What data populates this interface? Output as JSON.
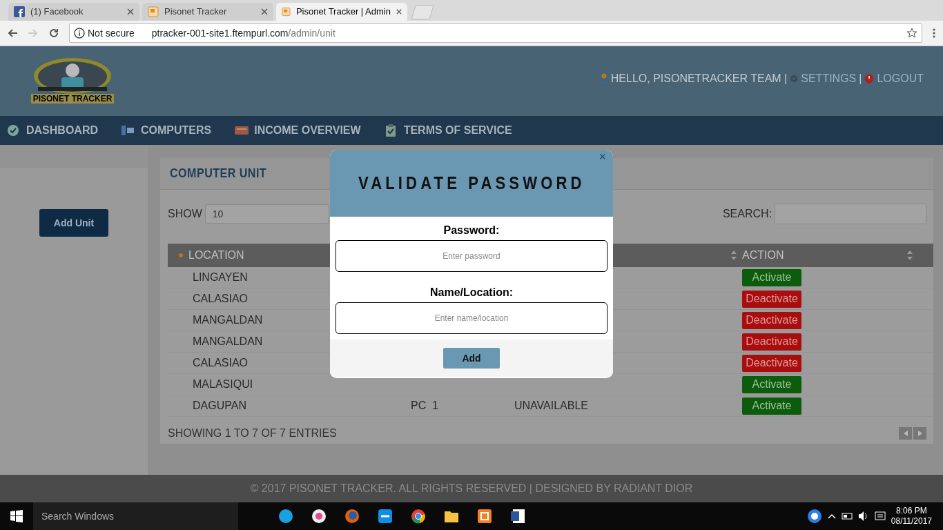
{
  "browser": {
    "tabs": [
      {
        "title": "(1) Facebook",
        "kind": "facebook",
        "selected": false
      },
      {
        "title": "Pisonet Tracker",
        "kind": "site",
        "selected": false
      },
      {
        "title": "Pisonet Tracker | Admin",
        "kind": "site",
        "selected": true
      }
    ],
    "address": {
      "security": "Not secure",
      "host": "ptracker-001-site1.ftempurl.com",
      "path": "/admin/unit"
    }
  },
  "header": {
    "logo_text": "PISONET TRACKER",
    "greeting": "HELLO, PISONETRACKER TEAM |",
    "settings": "SETTINGS",
    "separator": "|",
    "logout": "LOGOUT"
  },
  "nav": [
    {
      "label": "DASHBOARD",
      "kind": "dashboard"
    },
    {
      "label": "COMPUTERS",
      "kind": "computers"
    },
    {
      "label": "INCOME OVERVIEW",
      "kind": "income"
    },
    {
      "label": "TERMS OF SERVICE",
      "kind": "terms"
    }
  ],
  "sidebar": {
    "add_button": "Add Unit"
  },
  "panel": {
    "title": "COMPUTER UNIT",
    "show_label": "SHOW",
    "show_value": "10",
    "search_label": "SEARCH:",
    "columns": [
      "LOCATION",
      "ACTION"
    ],
    "rows": [
      {
        "location": "LINGAYEN",
        "action": {
          "label": "Activate",
          "kind": "activate"
        }
      },
      {
        "location": "CALASIAO",
        "action": {
          "label": "Deactivate",
          "kind": "deactivate"
        }
      },
      {
        "location": "MANGALDAN",
        "action": {
          "label": "Deactivate",
          "kind": "deactivate"
        }
      },
      {
        "location": "MANGALDAN",
        "action": {
          "label": "Deactivate",
          "kind": "deactivate"
        }
      },
      {
        "location": "CALASIAO",
        "action": {
          "label": "Deactivate",
          "kind": "deactivate"
        }
      },
      {
        "location": "MALASIQUI",
        "action": {
          "label": "Activate",
          "kind": "activate"
        }
      },
      {
        "location": "DAGUPAN",
        "unit": "PC  1",
        "status": "UNAVAILABLE",
        "action": {
          "label": "Activate",
          "kind": "activate"
        }
      }
    ],
    "info": "SHOWING 1 TO 7 OF 7 ENTRIES"
  },
  "modal": {
    "close": "×",
    "title": "VALIDATE PASSWORD",
    "fields": [
      {
        "label": "Password:",
        "placeholder": "Enter password"
      },
      {
        "label": "Name/Location:",
        "placeholder": "Enter name/location"
      }
    ],
    "submit": "Add"
  },
  "footer": "© 2017 PISONET TRACKER. ALL RIGHTS RESERVED | DESIGNED BY RADIANT DIOR",
  "taskbar": {
    "search": "Search Windows",
    "time": "8:06 PM",
    "date": "08/11/2017"
  }
}
